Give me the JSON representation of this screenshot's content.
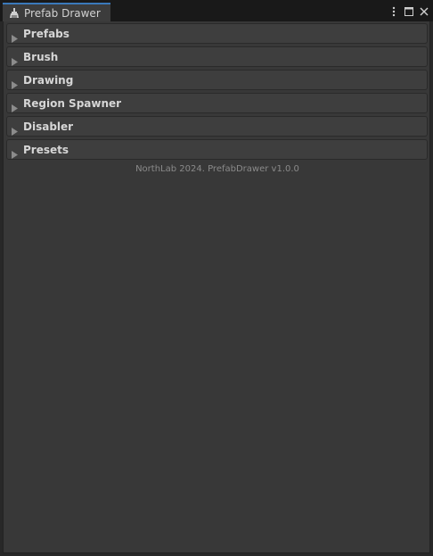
{
  "window": {
    "tab_title": "Prefab Drawer",
    "tab_icon": "brush-icon",
    "controls": [
      "more-options-icon",
      "maximize-icon",
      "close-icon"
    ]
  },
  "sections": [
    {
      "label": "Prefabs",
      "expanded": false
    },
    {
      "label": "Brush",
      "expanded": false
    },
    {
      "label": "Drawing",
      "expanded": false
    },
    {
      "label": "Region Spawner",
      "expanded": false
    },
    {
      "label": "Disabler",
      "expanded": false
    },
    {
      "label": "Presets",
      "expanded": false
    }
  ],
  "footer": "NorthLab 2024. PrefabDrawer v1.0.0",
  "colors": {
    "accent": "#3a79bb",
    "background": "#383838",
    "foldout_bg": "#3e3e3e",
    "text": "#d6d6d6",
    "footer_text": "#8a8a8a"
  }
}
